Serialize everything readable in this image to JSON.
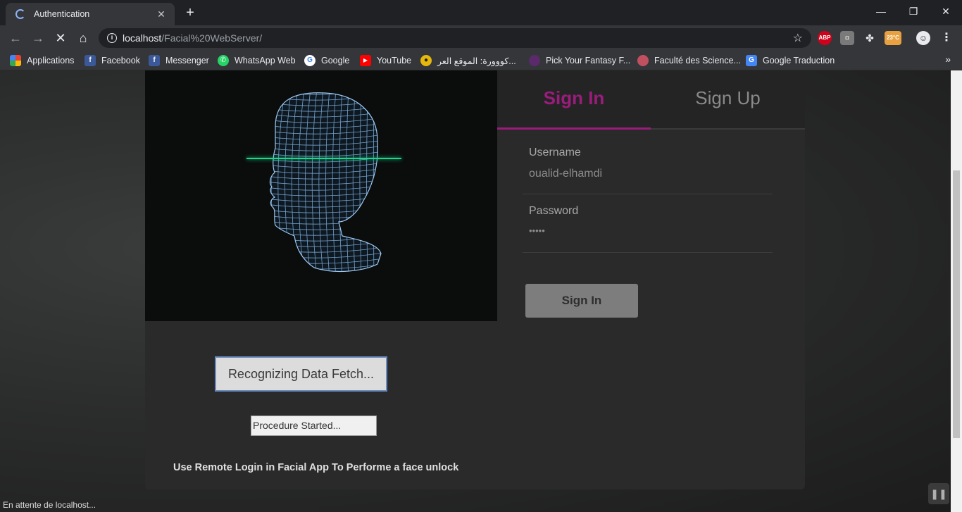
{
  "browser": {
    "tab_title": "Authentication",
    "url_host": "localhost",
    "url_path": "/Facial%20WebServer/",
    "status_text": "En attente de localhost..."
  },
  "bookmarks": [
    {
      "label": "Applications",
      "icon": "apps-grid-icon",
      "color": "#ea4335"
    },
    {
      "label": "Facebook",
      "icon": "facebook-icon",
      "color": "#3b5998"
    },
    {
      "label": "Messenger",
      "icon": "facebook-icon",
      "color": "#3b5998"
    },
    {
      "label": "WhatsApp Web",
      "icon": "whatsapp-icon",
      "color": "#25d366"
    },
    {
      "label": "Google",
      "icon": "google-icon",
      "color": "#ffffff"
    },
    {
      "label": "YouTube",
      "icon": "youtube-icon",
      "color": "#ff0000"
    },
    {
      "label": "كووورة: الموقع العر...",
      "icon": "kooora-icon",
      "color": "#e5b80b"
    },
    {
      "label": "Pick Your Fantasy F...",
      "icon": "fantasy-icon",
      "color": "#5a2a6b"
    },
    {
      "label": "Faculté des Science...",
      "icon": "faculty-icon",
      "color": "#c05060"
    },
    {
      "label": "Google Traduction",
      "icon": "google-translate-icon",
      "color": "#4285f4"
    }
  ],
  "auth": {
    "tab_signin": "Sign In",
    "tab_signup": "Sign Up",
    "username_label": "Username",
    "username_value": "oualid-elhamdi",
    "password_label": "Password",
    "password_value": "•••••",
    "signin_button": "Sign In",
    "recognize_button": "Recognizing Data Fetch...",
    "procedure_status": "Procedure Started...",
    "remote_text": "Use Remote Login in Facial App To Performe a face unlock"
  },
  "colors": {
    "accent": "#9b1c7c",
    "scan_line": "#19d98a",
    "mesh": "#7fb2e0"
  }
}
